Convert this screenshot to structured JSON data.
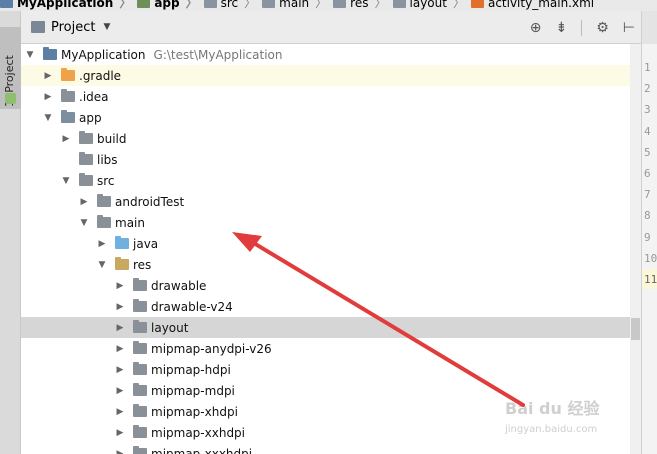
{
  "breadcrumb": [
    {
      "label": "MyApplication",
      "icon": "project-icon",
      "bold": true
    },
    {
      "label": "app",
      "icon": "module-icon",
      "bold": true
    },
    {
      "label": "src",
      "icon": "folder-icon",
      "bold": false
    },
    {
      "label": "main",
      "icon": "folder-icon",
      "bold": false
    },
    {
      "label": "res",
      "icon": "folder-icon",
      "bold": false
    },
    {
      "label": "layout",
      "icon": "folder-icon",
      "bold": false
    },
    {
      "label": "activity_main.xml",
      "icon": "xml-file-icon",
      "bold": false
    }
  ],
  "side_stripe": {
    "tab_label": "1: Project"
  },
  "panel": {
    "title": "Project",
    "tools": [
      "locate-icon",
      "collapse-icon",
      "gear-icon",
      "hide-icon"
    ]
  },
  "tree": [
    {
      "label": "MyApplication",
      "path": "G:\\test\\MyApplication",
      "depth": 0,
      "expanded": true,
      "icon": "project-folder-icon",
      "color": "#5c7fa3"
    },
    {
      "label": ".gradle",
      "depth": 1,
      "expanded": false,
      "icon": "folder-icon",
      "color": "#f0a24a",
      "highlight": true
    },
    {
      "label": ".idea",
      "depth": 1,
      "expanded": false,
      "icon": "folder-icon",
      "color": "#8a9098"
    },
    {
      "label": "app",
      "depth": 1,
      "expanded": true,
      "icon": "module-folder-icon",
      "color": "#7d8f9e"
    },
    {
      "label": "build",
      "depth": 2,
      "expanded": false,
      "icon": "folder-icon",
      "color": "#8a9098"
    },
    {
      "label": "libs",
      "depth": 2,
      "leaf": true,
      "icon": "folder-icon",
      "color": "#8a9098"
    },
    {
      "label": "src",
      "depth": 2,
      "expanded": true,
      "icon": "folder-icon",
      "color": "#8a9098"
    },
    {
      "label": "androidTest",
      "depth": 3,
      "expanded": false,
      "icon": "folder-icon",
      "color": "#8a9098"
    },
    {
      "label": "main",
      "depth": 3,
      "expanded": true,
      "icon": "folder-icon",
      "color": "#8a9098"
    },
    {
      "label": "java",
      "depth": 4,
      "expanded": false,
      "icon": "source-folder-icon",
      "color": "#6fb0e0"
    },
    {
      "label": "res",
      "depth": 4,
      "expanded": true,
      "icon": "resource-folder-icon",
      "color": "#c9a860"
    },
    {
      "label": "drawable",
      "depth": 5,
      "expanded": false,
      "icon": "folder-icon",
      "color": "#8a9098"
    },
    {
      "label": "drawable-v24",
      "depth": 5,
      "expanded": false,
      "icon": "folder-icon",
      "color": "#8a9098"
    },
    {
      "label": "layout",
      "depth": 5,
      "expanded": false,
      "icon": "folder-icon",
      "color": "#8a9098",
      "selected": true
    },
    {
      "label": "mipmap-anydpi-v26",
      "depth": 5,
      "expanded": false,
      "icon": "folder-icon",
      "color": "#8a9098"
    },
    {
      "label": "mipmap-hdpi",
      "depth": 5,
      "expanded": false,
      "icon": "folder-icon",
      "color": "#8a9098"
    },
    {
      "label": "mipmap-mdpi",
      "depth": 5,
      "expanded": false,
      "icon": "folder-icon",
      "color": "#8a9098"
    },
    {
      "label": "mipmap-xhdpi",
      "depth": 5,
      "expanded": false,
      "icon": "folder-icon",
      "color": "#8a9098"
    },
    {
      "label": "mipmap-xxhdpi",
      "depth": 5,
      "expanded": false,
      "icon": "folder-icon",
      "color": "#8a9098"
    },
    {
      "label": "mipmap-xxxhdpi",
      "depth": 5,
      "expanded": false,
      "icon": "folder-icon",
      "color": "#8a9098"
    }
  ],
  "gutter_lines": [
    "1",
    "2",
    "3",
    "4",
    "5",
    "6",
    "7",
    "8",
    "9",
    "10",
    "11"
  ],
  "watermark": {
    "text": "Bai du 经验",
    "sub": "jingyan.baidu.com"
  },
  "annotation_color": "#e23b3b"
}
